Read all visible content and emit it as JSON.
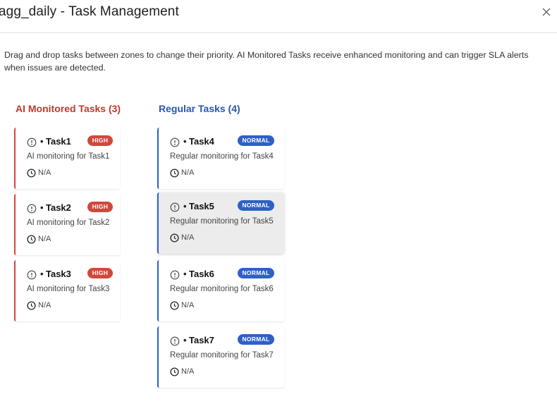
{
  "header": {
    "title": "agg_daily - Task Management",
    "close_icon": "close-icon"
  },
  "description": "Drag and drop tasks between zones to change their priority. AI Monitored Tasks receive enhanced monitoring and can trigger SLA alerts when issues are detected.",
  "colors": {
    "ai_accent": "#d2473b",
    "regular_accent": "#2e60c6"
  },
  "zones": {
    "ai": {
      "title": "AI Monitored Tasks (3)",
      "tasks": [
        {
          "name": "Task1",
          "badge": "HIGH",
          "description": "AI monitoring for Task1",
          "sla": "N/A"
        },
        {
          "name": "Task2",
          "badge": "HIGH",
          "description": "AI monitoring for Task2",
          "sla": "N/A"
        },
        {
          "name": "Task3",
          "badge": "HIGH",
          "description": "AI monitoring for Task3",
          "sla": "N/A"
        }
      ]
    },
    "regular": {
      "title": "Regular Tasks (4)",
      "tasks": [
        {
          "name": "Task4",
          "badge": "NORMAL",
          "description": "Regular monitoring for Task4",
          "sla": "N/A"
        },
        {
          "name": "Task5",
          "badge": "NORMAL",
          "description": "Regular monitoring for Task5",
          "sla": "N/A"
        },
        {
          "name": "Task6",
          "badge": "NORMAL",
          "description": "Regular monitoring for Task6",
          "sla": "N/A"
        },
        {
          "name": "Task7",
          "badge": "NORMAL",
          "description": "Regular monitoring for Task7",
          "sla": "N/A"
        }
      ]
    }
  },
  "task_bullet": "•"
}
